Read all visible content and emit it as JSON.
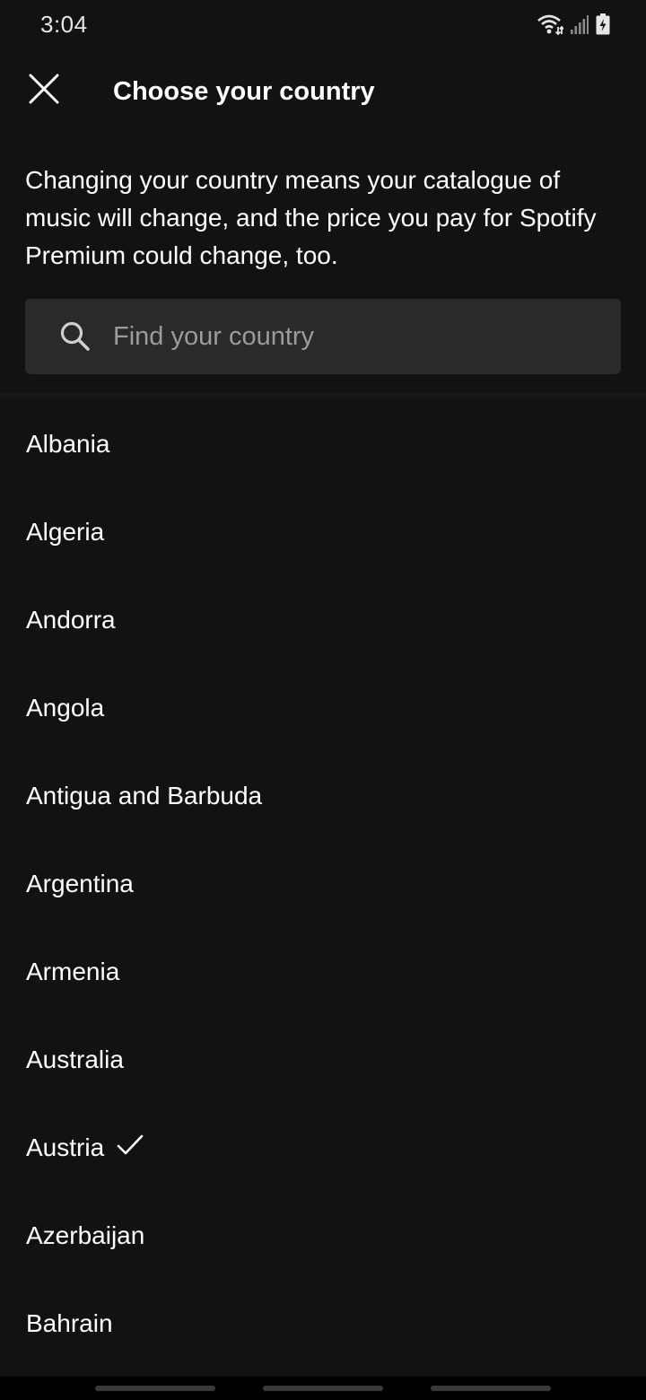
{
  "status_bar": {
    "time": "3:04",
    "icons": [
      "wifi-icon",
      "signal-icon",
      "battery-charging-icon"
    ]
  },
  "header": {
    "close_icon": "close-icon",
    "title": "Choose your country"
  },
  "description": "Changing your country means your catalogue of music will change, and the price you pay for Spotify Premium could change, too.",
  "search": {
    "icon": "search-icon",
    "placeholder": "Find your country",
    "value": ""
  },
  "countries": [
    {
      "name": "Albania",
      "selected": false
    },
    {
      "name": "Algeria",
      "selected": false
    },
    {
      "name": "Andorra",
      "selected": false
    },
    {
      "name": "Angola",
      "selected": false
    },
    {
      "name": "Antigua and Barbuda",
      "selected": false
    },
    {
      "name": "Argentina",
      "selected": false
    },
    {
      "name": "Armenia",
      "selected": false
    },
    {
      "name": "Australia",
      "selected": false
    },
    {
      "name": "Austria",
      "selected": true
    },
    {
      "name": "Azerbaijan",
      "selected": false
    },
    {
      "name": "Bahrain",
      "selected": false
    }
  ],
  "colors": {
    "background": "#121212",
    "search_background": "#2a2a2a",
    "text": "#ffffff",
    "placeholder": "#9b9b9b"
  }
}
